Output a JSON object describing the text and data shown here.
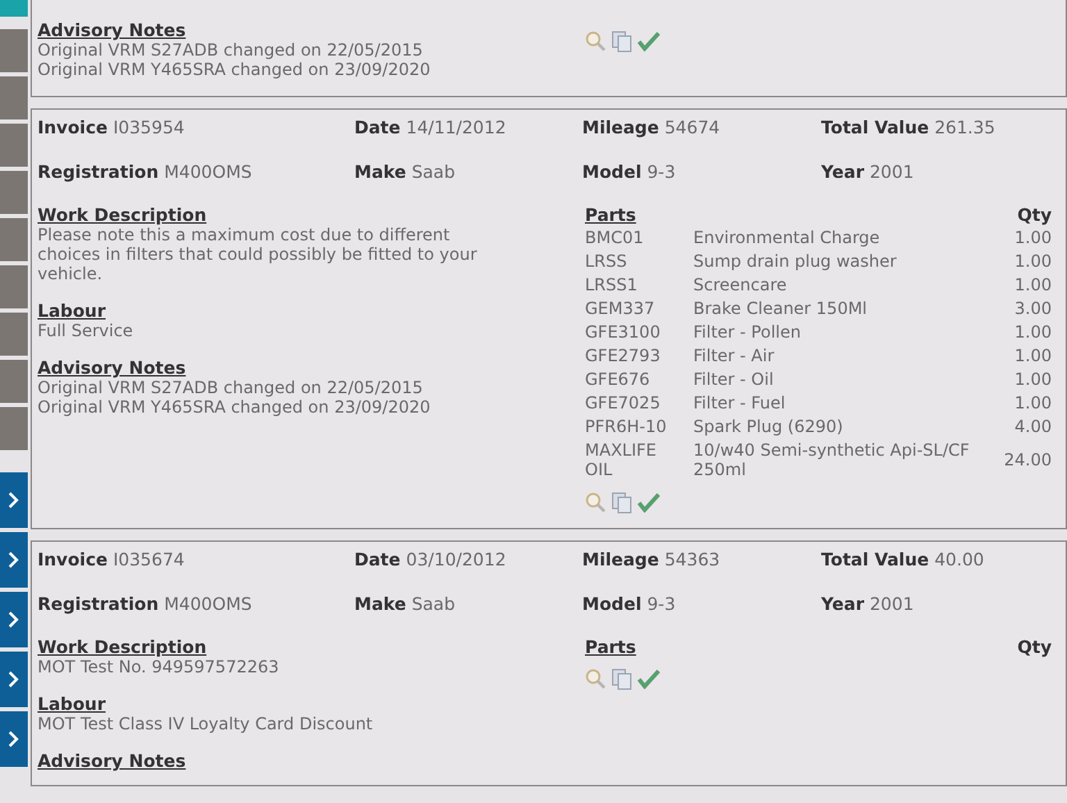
{
  "sidebar": {
    "items": [
      {
        "kind": "accent"
      },
      {
        "kind": "plain"
      },
      {
        "kind": "plain"
      },
      {
        "kind": "plain"
      },
      {
        "kind": "plain"
      },
      {
        "kind": "plain"
      },
      {
        "kind": "plain"
      },
      {
        "kind": "plain"
      },
      {
        "kind": "plain"
      },
      {
        "kind": "plain"
      },
      {
        "kind": "arrow"
      },
      {
        "kind": "arrow"
      },
      {
        "kind": "arrow"
      },
      {
        "kind": "arrow"
      },
      {
        "kind": "arrow"
      }
    ]
  },
  "previous_card": {
    "advisory_heading": "Advisory Notes",
    "advisory_lines": [
      "Original VRM S27ADB changed on 22/05/2015",
      "Original VRM Y465SRA changed on 23/09/2020"
    ]
  },
  "invoices": [
    {
      "fields": [
        {
          "label": "Invoice",
          "value": "I035954"
        },
        {
          "label": "Date",
          "value": "14/11/2012"
        },
        {
          "label": "Mileage",
          "value": "54674"
        },
        {
          "label": "Total Value",
          "value": "261.35"
        },
        {
          "label": "Registration",
          "value": "M400OMS"
        },
        {
          "label": "Make",
          "value": "Saab"
        },
        {
          "label": "Model",
          "value": "9-3"
        },
        {
          "label": "Year",
          "value": "2001"
        }
      ],
      "sections": [
        {
          "heading": "Work Description",
          "lines": [
            "Please note this a maximum cost due to different choices in filters that could possibly be fitted to your vehicle."
          ]
        },
        {
          "heading": "Labour",
          "lines": [
            "Full Service"
          ]
        },
        {
          "heading": "Advisory Notes",
          "lines": [
            "Original VRM S27ADB changed on 22/05/2015",
            "Original VRM Y465SRA changed on 23/09/2020"
          ]
        }
      ],
      "parts_heading": "Parts",
      "qty_heading": "Qty",
      "parts": [
        {
          "code": "BMC01",
          "description": "Environmental Charge",
          "qty": "1.00"
        },
        {
          "code": "LRSS",
          "description": "Sump drain plug washer",
          "qty": "1.00"
        },
        {
          "code": "LRSS1",
          "description": "Screencare",
          "qty": "1.00"
        },
        {
          "code": "GEM337",
          "description": "Brake Cleaner 150Ml",
          "qty": "3.00"
        },
        {
          "code": "GFE3100",
          "description": "Filter - Pollen",
          "qty": "1.00"
        },
        {
          "code": "GFE2793",
          "description": "Filter - Air",
          "qty": "1.00"
        },
        {
          "code": "GFE676",
          "description": "Filter - Oil",
          "qty": "1.00"
        },
        {
          "code": "GFE7025",
          "description": "Filter - Fuel",
          "qty": "1.00"
        },
        {
          "code": "PFR6H-10",
          "description": "Spark Plug (6290)",
          "qty": "4.00"
        },
        {
          "code": "MAXLIFE OIL",
          "description": "10/w40 Semi-synthetic Api-SL/CF 250ml",
          "qty": "24.00"
        }
      ]
    },
    {
      "fields": [
        {
          "label": "Invoice",
          "value": "I035674"
        },
        {
          "label": "Date",
          "value": "03/10/2012"
        },
        {
          "label": "Mileage",
          "value": "54363"
        },
        {
          "label": "Total Value",
          "value": "40.00"
        },
        {
          "label": "Registration",
          "value": "M400OMS"
        },
        {
          "label": "Make",
          "value": "Saab"
        },
        {
          "label": "Model",
          "value": "9-3"
        },
        {
          "label": "Year",
          "value": "2001"
        }
      ],
      "sections": [
        {
          "heading": "Work Description",
          "lines": [
            "MOT Test No. 949597572263"
          ]
        },
        {
          "heading": "Labour",
          "lines": [
            "MOT Test Class IV Loyalty Card Discount"
          ]
        },
        {
          "heading": "Advisory Notes"
        }
      ],
      "parts_heading": "Parts",
      "qty_heading": "Qty"
    }
  ]
}
